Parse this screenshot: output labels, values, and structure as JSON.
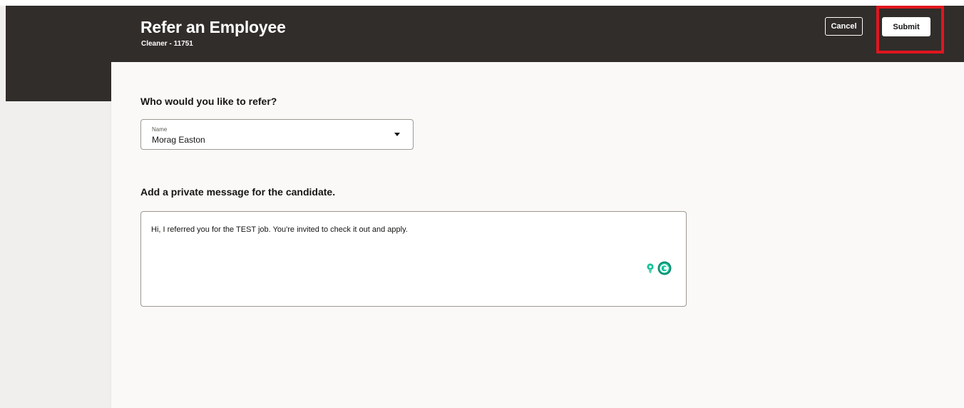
{
  "header": {
    "title": "Refer an Employee",
    "subtitle": "Cleaner - 11751",
    "cancel_label": "Cancel",
    "submit_label": "Submit"
  },
  "form": {
    "who_heading": "Who would you like to refer?",
    "name_field": {
      "label": "Name",
      "value": "Morag Easton"
    },
    "message_heading": "Add a private message for the candidate.",
    "message_value": "Hi, I referred you for the TEST job. You're invited to check it out and apply.",
    "extension_icons": [
      "lightbulb-icon",
      "grammarly-icon"
    ]
  },
  "colors": {
    "header_bg": "#312d2a",
    "page_bg": "#f1efed",
    "card_bg": "#fbf9f8",
    "highlight": "#e0161f",
    "grammarly_green": "#15c39a"
  }
}
